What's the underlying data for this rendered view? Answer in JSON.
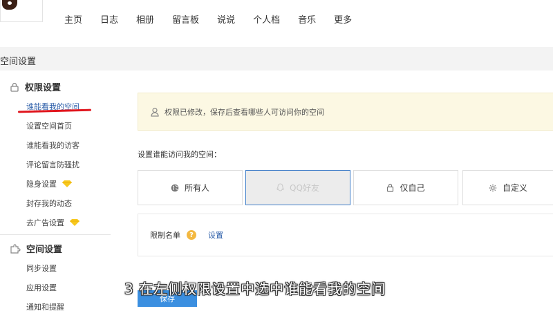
{
  "nav": {
    "items": [
      "主页",
      "日志",
      "相册",
      "留言板",
      "说说",
      "个人档",
      "音乐",
      "更多"
    ]
  },
  "page": {
    "title": "空间设置"
  },
  "sidebar": {
    "section1": {
      "title": "权限设置",
      "items": [
        "谁能看我的空间",
        "设置空间首页",
        "谁能看我的访客",
        "评论留言防骚扰",
        "隐身设置",
        "封存我的动态",
        "去广告设置"
      ]
    },
    "section2": {
      "title": "空间设置",
      "items": [
        "同步设置",
        "应用设置",
        "通知和提醒"
      ]
    }
  },
  "main": {
    "notice": "权限已修改，保存后查看哪些人可访问你的空间",
    "who_label": "设置谁能访问我的空间：",
    "options": [
      "所有人",
      "QQ好友",
      "仅自己",
      "自定义"
    ],
    "restrict_label": "限制名单",
    "restrict_link": "设置",
    "save_label": "保存"
  },
  "caption": "3 在左侧权限设置中选中谁能看我的空间",
  "colors": {
    "accent": "#3b8fe0",
    "link": "#2a5ca8",
    "highlight": "#e0151d",
    "notice_bg": "#fcf8e3"
  }
}
